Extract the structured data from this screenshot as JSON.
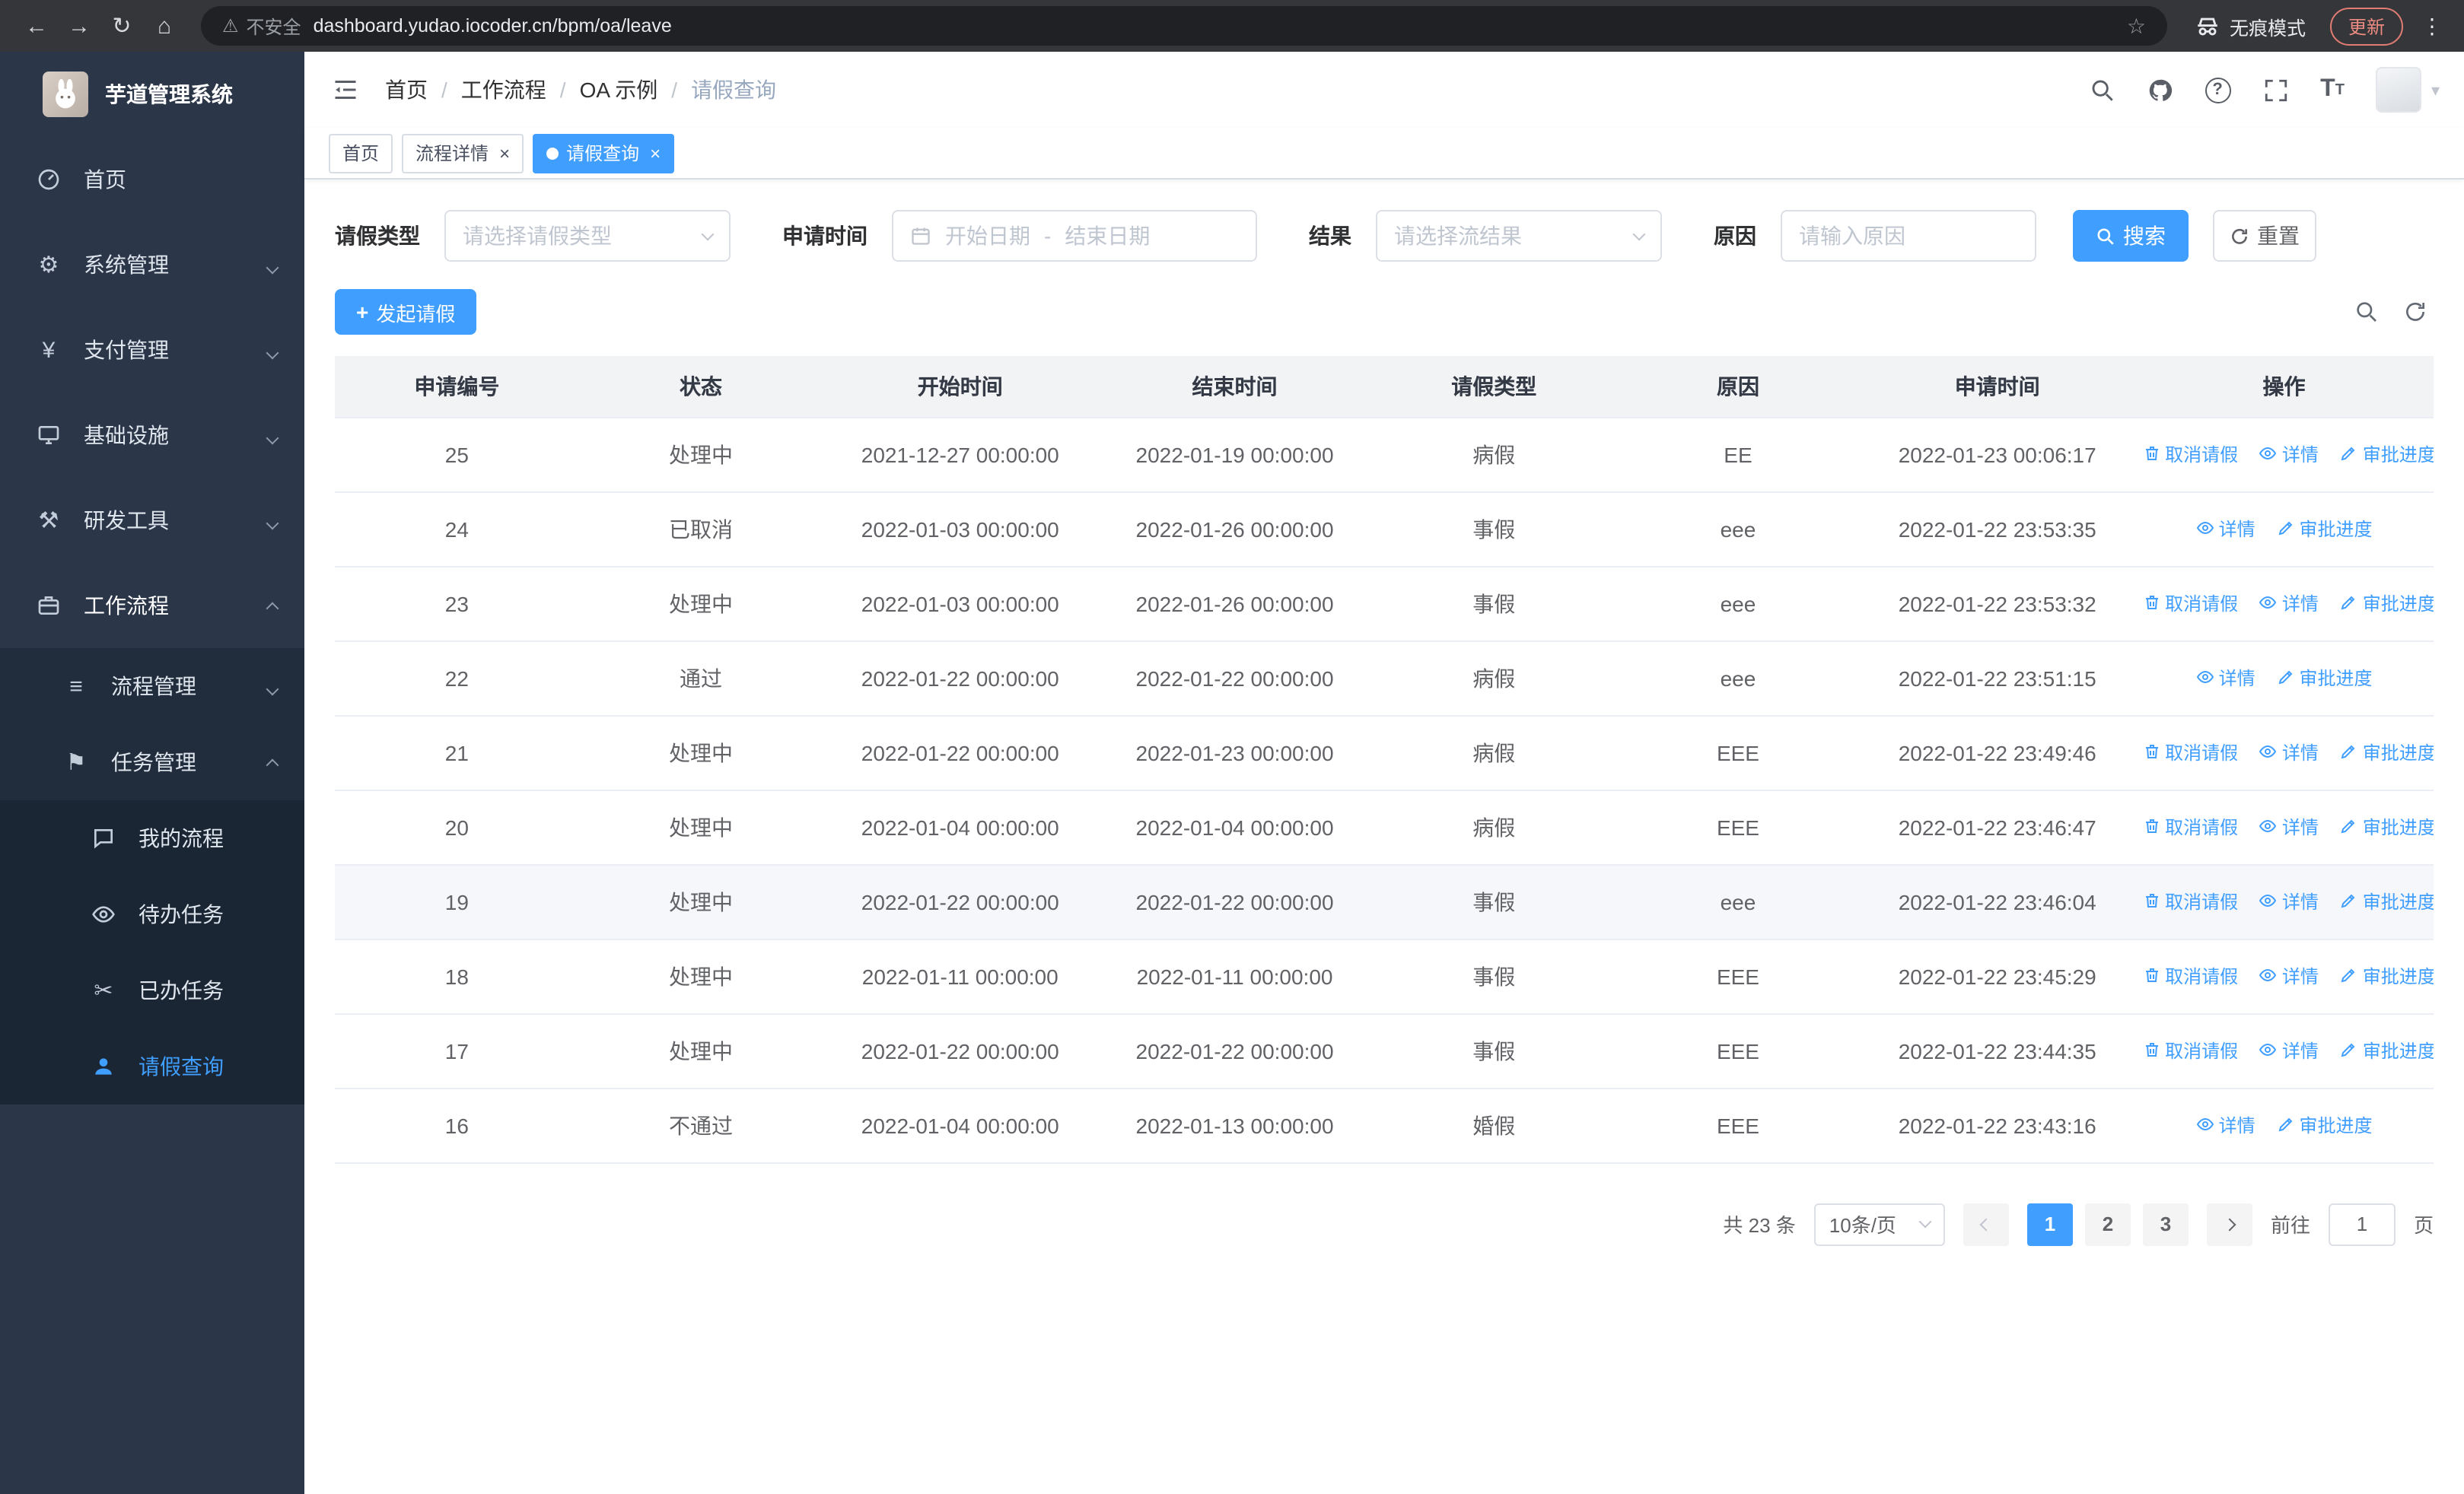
{
  "browser": {
    "security_label": "不安全",
    "url": "dashboard.yudao.iocoder.cn/bpm/oa/leave",
    "incognito_label": "无痕模式",
    "update_label": "更新"
  },
  "icons": {
    "back": "←",
    "forward": "→",
    "reload": "↻",
    "home": "⌂",
    "warning": "⚠",
    "star": "☆",
    "menu_dots": "⋮",
    "gear": "⚙",
    "yen": "¥",
    "tool": "⚒",
    "flag": "⚑",
    "list": "≡",
    "scissors": "✂",
    "caret_down": "▾",
    "plus": "+",
    "question": "?",
    "font_size": "T",
    "close": "×",
    "dash": "-"
  },
  "sidebar": {
    "logo_title": "芋道管理系统",
    "items": [
      {
        "label": "首页"
      },
      {
        "label": "系统管理"
      },
      {
        "label": "支付管理"
      },
      {
        "label": "基础设施"
      },
      {
        "label": "研发工具"
      },
      {
        "label": "工作流程"
      },
      {
        "label": "流程管理"
      },
      {
        "label": "任务管理"
      },
      {
        "label": "我的流程"
      },
      {
        "label": "待办任务"
      },
      {
        "label": "已办任务"
      },
      {
        "label": "请假查询"
      }
    ]
  },
  "header": {
    "breadcrumb": [
      "首页",
      "工作流程",
      "OA 示例",
      "请假查询"
    ]
  },
  "tabs": [
    {
      "label": "首页"
    },
    {
      "label": "流程详情"
    },
    {
      "label": "请假查询"
    }
  ],
  "filters": {
    "leave_type_label": "请假类型",
    "leave_type_placeholder": "请选择请假类型",
    "apply_time_label": "申请时间",
    "start_date_placeholder": "开始日期",
    "date_separator": "-",
    "end_date_placeholder": "结束日期",
    "result_label": "结果",
    "result_placeholder": "请选择流结果",
    "reason_label": "原因",
    "reason_placeholder": "请输入原因",
    "search_label": "搜索",
    "reset_label": "重置"
  },
  "toolbar": {
    "create_label": "发起请假"
  },
  "table": {
    "columns": [
      "申请编号",
      "状态",
      "开始时间",
      "结束时间",
      "请假类型",
      "原因",
      "申请时间",
      "操作"
    ],
    "actions": {
      "cancel": "取消请假",
      "detail": "详情",
      "progress": "审批进度"
    },
    "rows": [
      {
        "id": "25",
        "status": "处理中",
        "start": "2021-12-27 00:00:00",
        "end": "2022-01-19 00:00:00",
        "type": "病假",
        "reason": "EE",
        "applied": "2022-01-23 00:06:17",
        "cancelable": true,
        "highlighted": false
      },
      {
        "id": "24",
        "status": "已取消",
        "start": "2022-01-03 00:00:00",
        "end": "2022-01-26 00:00:00",
        "type": "事假",
        "reason": "eee",
        "applied": "2022-01-22 23:53:35",
        "cancelable": false,
        "highlighted": false
      },
      {
        "id": "23",
        "status": "处理中",
        "start": "2022-01-03 00:00:00",
        "end": "2022-01-26 00:00:00",
        "type": "事假",
        "reason": "eee",
        "applied": "2022-01-22 23:53:32",
        "cancelable": true,
        "highlighted": false
      },
      {
        "id": "22",
        "status": "通过",
        "start": "2022-01-22 00:00:00",
        "end": "2022-01-22 00:00:00",
        "type": "病假",
        "reason": "eee",
        "applied": "2022-01-22 23:51:15",
        "cancelable": false,
        "highlighted": false
      },
      {
        "id": "21",
        "status": "处理中",
        "start": "2022-01-22 00:00:00",
        "end": "2022-01-23 00:00:00",
        "type": "病假",
        "reason": "EEE",
        "applied": "2022-01-22 23:49:46",
        "cancelable": true,
        "highlighted": false
      },
      {
        "id": "20",
        "status": "处理中",
        "start": "2022-01-04 00:00:00",
        "end": "2022-01-04 00:00:00",
        "type": "病假",
        "reason": "EEE",
        "applied": "2022-01-22 23:46:47",
        "cancelable": true,
        "highlighted": false
      },
      {
        "id": "19",
        "status": "处理中",
        "start": "2022-01-22 00:00:00",
        "end": "2022-01-22 00:00:00",
        "type": "事假",
        "reason": "eee",
        "applied": "2022-01-22 23:46:04",
        "cancelable": true,
        "highlighted": true
      },
      {
        "id": "18",
        "status": "处理中",
        "start": "2022-01-11 00:00:00",
        "end": "2022-01-11 00:00:00",
        "type": "事假",
        "reason": "EEE",
        "applied": "2022-01-22 23:45:29",
        "cancelable": true,
        "highlighted": false
      },
      {
        "id": "17",
        "status": "处理中",
        "start": "2022-01-22 00:00:00",
        "end": "2022-01-22 00:00:00",
        "type": "事假",
        "reason": "EEE",
        "applied": "2022-01-22 23:44:35",
        "cancelable": true,
        "highlighted": false
      },
      {
        "id": "16",
        "status": "不通过",
        "start": "2022-01-04 00:00:00",
        "end": "2022-01-13 00:00:00",
        "type": "婚假",
        "reason": "EEE",
        "applied": "2022-01-22 23:43:16",
        "cancelable": false,
        "highlighted": false
      }
    ]
  },
  "pagination": {
    "total_label": "共 23 条",
    "page_size_label": "10条/页",
    "pages": [
      "1",
      "2",
      "3"
    ],
    "active_page": "1",
    "goto_label": "前往",
    "goto_value": "1",
    "page_unit_label": "页"
  },
  "colors": {
    "primary": "#409eff",
    "sidebar_bg": "#2b3648"
  }
}
